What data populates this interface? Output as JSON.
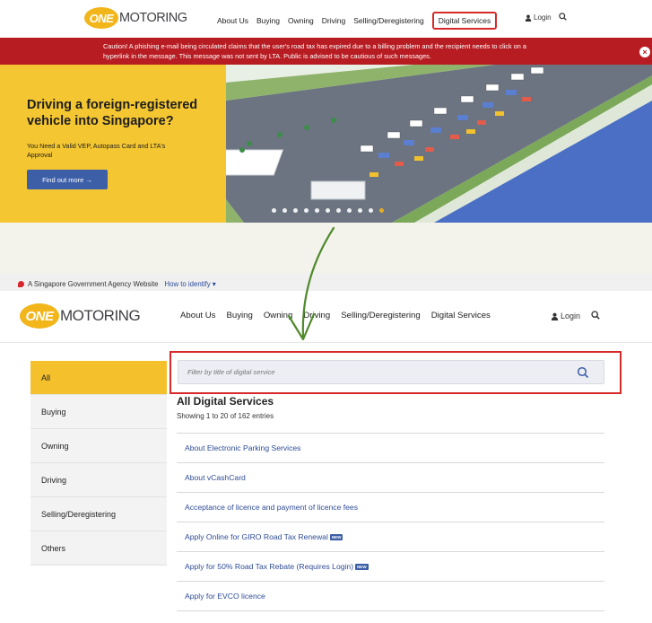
{
  "brand": {
    "logo_badge": "ONE",
    "logo_text": "MOTORING",
    "logo_color": "#f2b51a"
  },
  "top": {
    "nav": [
      "About Us",
      "Buying",
      "Owning",
      "Driving",
      "Selling/Deregistering"
    ],
    "highlighted_nav": "Digital Services",
    "login_label": "Login",
    "alert_text": "Caution! A phishing e-mail being circulated claims that the user's road tax has expired due to a billing problem and the recipient needs to click on a hyperlink in the message. This message was not sent by LTA. Public is advised to be cautious of such messages.",
    "alert_color": "#b71c22",
    "banner": {
      "title": "Driving a foreign-registered vehicle into Singapore?",
      "subtitle": "You Need a Valid VEP, Autopass Card and LTA's Approval",
      "button_label": "Find out more →",
      "slides_total": 11,
      "active_slide": 11
    }
  },
  "gov_bar": {
    "text": "A Singapore Government Agency Website",
    "link": "How to identify ▾"
  },
  "bottom": {
    "nav": [
      "About Us",
      "Buying",
      "Owning",
      "Driving",
      "Selling/Deregistering",
      "Digital Services"
    ],
    "login_label": "Login",
    "sidebar": [
      "All",
      "Buying",
      "Owning",
      "Driving",
      "Selling/Deregistering",
      "Others"
    ],
    "active_category": "All",
    "search_placeholder": "Filter by title of digital service",
    "list_title": "All Digital Services",
    "list_count": "Showing 1 to 20 of 162 entries",
    "new_badge": "NEW",
    "services": [
      {
        "label": "About Electronic Parking Services",
        "new": false
      },
      {
        "label": "About vCashCard",
        "new": false
      },
      {
        "label": "Acceptance of licence and payment of licence fees",
        "new": false
      },
      {
        "label": "Apply Online for GIRO Road Tax Renewal",
        "new": true
      },
      {
        "label": "Apply for 50% Road Tax Rebate (Requires Login)",
        "new": true
      },
      {
        "label": "Apply for EVCO licence",
        "new": false
      }
    ],
    "accent_yellow": "#f4c02c",
    "highlight_red": "#d62a2a"
  }
}
